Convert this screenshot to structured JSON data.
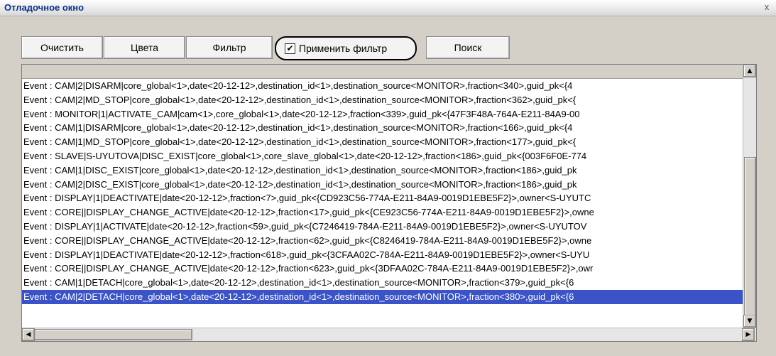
{
  "window": {
    "title": "Отладочное окно",
    "close_glyph": "x"
  },
  "toolbar": {
    "clear_label": "Очистить",
    "colors_label": "Цвета",
    "filter_label": "Фильтр",
    "apply_filter_label": "Применить фильтр",
    "apply_filter_checked": true,
    "apply_filter_check_glyph": "✔",
    "search_label": "Поиск"
  },
  "scroll": {
    "up_glyph": "▲",
    "down_glyph": "▼",
    "left_glyph": "◀",
    "right_glyph": "▶"
  },
  "log": {
    "rows": [
      "Event : CAM|2|DISARM|core_global<1>,date<20-12-12>,destination_id<1>,destination_source<MONITOR>,fraction<340>,guid_pk<{4",
      "Event : CAM|2|MD_STOP|core_global<1>,date<20-12-12>,destination_id<1>,destination_source<MONITOR>,fraction<362>,guid_pk<{",
      "Event : MONITOR|1|ACTIVATE_CAM|cam<1>,core_global<1>,date<20-12-12>,fraction<339>,guid_pk<{47F3F48A-764A-E211-84A9-00",
      "Event : CAM|1|DISARM|core_global<1>,date<20-12-12>,destination_id<1>,destination_source<MONITOR>,fraction<166>,guid_pk<{4",
      "Event : CAM|1|MD_STOP|core_global<1>,date<20-12-12>,destination_id<1>,destination_source<MONITOR>,fraction<177>,guid_pk<{",
      "Event : SLAVE|S-UYUTOVA|DISC_EXIST|core_global<1>,core_slave_global<1>,date<20-12-12>,fraction<186>,guid_pk<{003F6F0E-774",
      "Event : CAM|1|DISC_EXIST|core_global<1>,date<20-12-12>,destination_id<1>,destination_source<MONITOR>,fraction<186>,guid_pk",
      "Event : CAM|2|DISC_EXIST|core_global<1>,date<20-12-12>,destination_id<1>,destination_source<MONITOR>,fraction<186>,guid_pk",
      "Event : DISPLAY|1|DEACTIVATE|date<20-12-12>,fraction<7>,guid_pk<{CD923C56-774A-E211-84A9-0019D1EBE5F2}>,owner<S-UYUTC",
      "Event : CORE||DISPLAY_CHANGE_ACTIVE|date<20-12-12>,fraction<17>,guid_pk<{CE923C56-774A-E211-84A9-0019D1EBE5F2}>,owne",
      "Event : DISPLAY|1|ACTIVATE|date<20-12-12>,fraction<59>,guid_pk<{C7246419-784A-E211-84A9-0019D1EBE5F2}>,owner<S-UYUTOV",
      "Event : CORE||DISPLAY_CHANGE_ACTIVE|date<20-12-12>,fraction<62>,guid_pk<{C8246419-784A-E211-84A9-0019D1EBE5F2}>,owne",
      "Event : DISPLAY|1|DEACTIVATE|date<20-12-12>,fraction<618>,guid_pk<{3CFAA02C-784A-E211-84A9-0019D1EBE5F2}>,owner<S-UYU",
      "Event : CORE||DISPLAY_CHANGE_ACTIVE|date<20-12-12>,fraction<623>,guid_pk<{3DFAA02C-784A-E211-84A9-0019D1EBE5F2}>,owr",
      "Event : CAM|1|DETACH|core_global<1>,date<20-12-12>,destination_id<1>,destination_source<MONITOR>,fraction<379>,guid_pk<{6",
      "Event : CAM|2|DETACH|core_global<1>,date<20-12-12>,destination_id<1>,destination_source<MONITOR>,fraction<380>,guid_pk<{6"
    ],
    "selected_index": 15
  },
  "colors": {
    "title_text": "#0b2f8a",
    "selection_bg": "#3a53c8",
    "window_bg": "#d4d0c8"
  }
}
